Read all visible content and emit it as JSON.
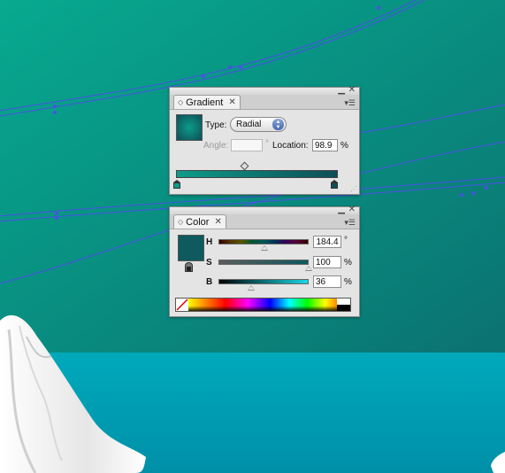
{
  "gradient_panel": {
    "tab_label": "Gradient",
    "type_label": "Type:",
    "type_value": "Radial",
    "angle_label": "Angle:",
    "angle_value": "",
    "angle_unit": "°",
    "location_label": "Location:",
    "location_value": "98.9",
    "location_unit": "%",
    "gradient_colors": [
      "#0d9c88",
      "#0d4e57"
    ],
    "swatch_color": "#0f6e6a"
  },
  "color_panel": {
    "tab_label": "Color",
    "h_label": "H",
    "h_value": "184.4",
    "h_unit": "°",
    "s_label": "S",
    "s_value": "100",
    "s_unit": "%",
    "b_label": "B",
    "b_value": "36",
    "b_unit": "%",
    "fill_color": "#0e5a5e",
    "h_fraction": 0.512,
    "s_fraction": 1.0,
    "b_fraction": 0.36
  },
  "colors": {
    "canvas_top": "#0aa48e",
    "canvas_bottom": "#08766f",
    "water": "#00a1b4",
    "path_stroke": "#4b50e6"
  }
}
